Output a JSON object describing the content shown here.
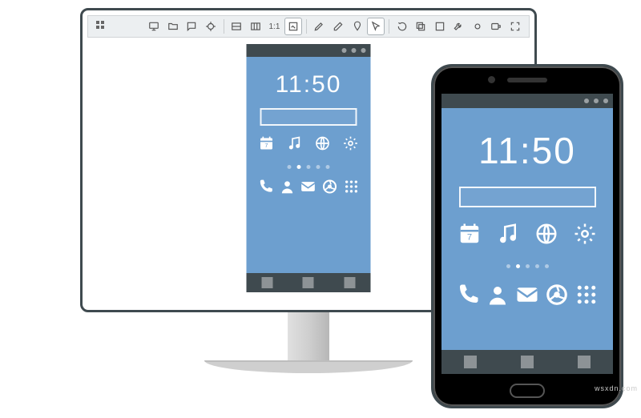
{
  "toolbar": {
    "icons": [
      "grid",
      "monitor",
      "folder",
      "comment",
      "target",
      "panel-h",
      "panel-v",
      "1:1",
      "edit",
      "pencil",
      "eraser",
      "pin",
      "pointer",
      "rotate",
      "layers",
      "expand",
      "wrench",
      "dot",
      "loop"
    ],
    "ratio_label": "1:1"
  },
  "simulator": {
    "clock": "11:50",
    "search_placeholder": "",
    "apps_row1": [
      "calendar",
      "music",
      "globe",
      "settings"
    ],
    "calendar_day": "7",
    "page_dots": {
      "count": 5,
      "active": 1
    },
    "dock": [
      "phone",
      "contacts",
      "mail",
      "browser",
      "apps"
    ],
    "nav": [
      "back",
      "home",
      "recent"
    ]
  },
  "watermark": "wsxdn.com"
}
